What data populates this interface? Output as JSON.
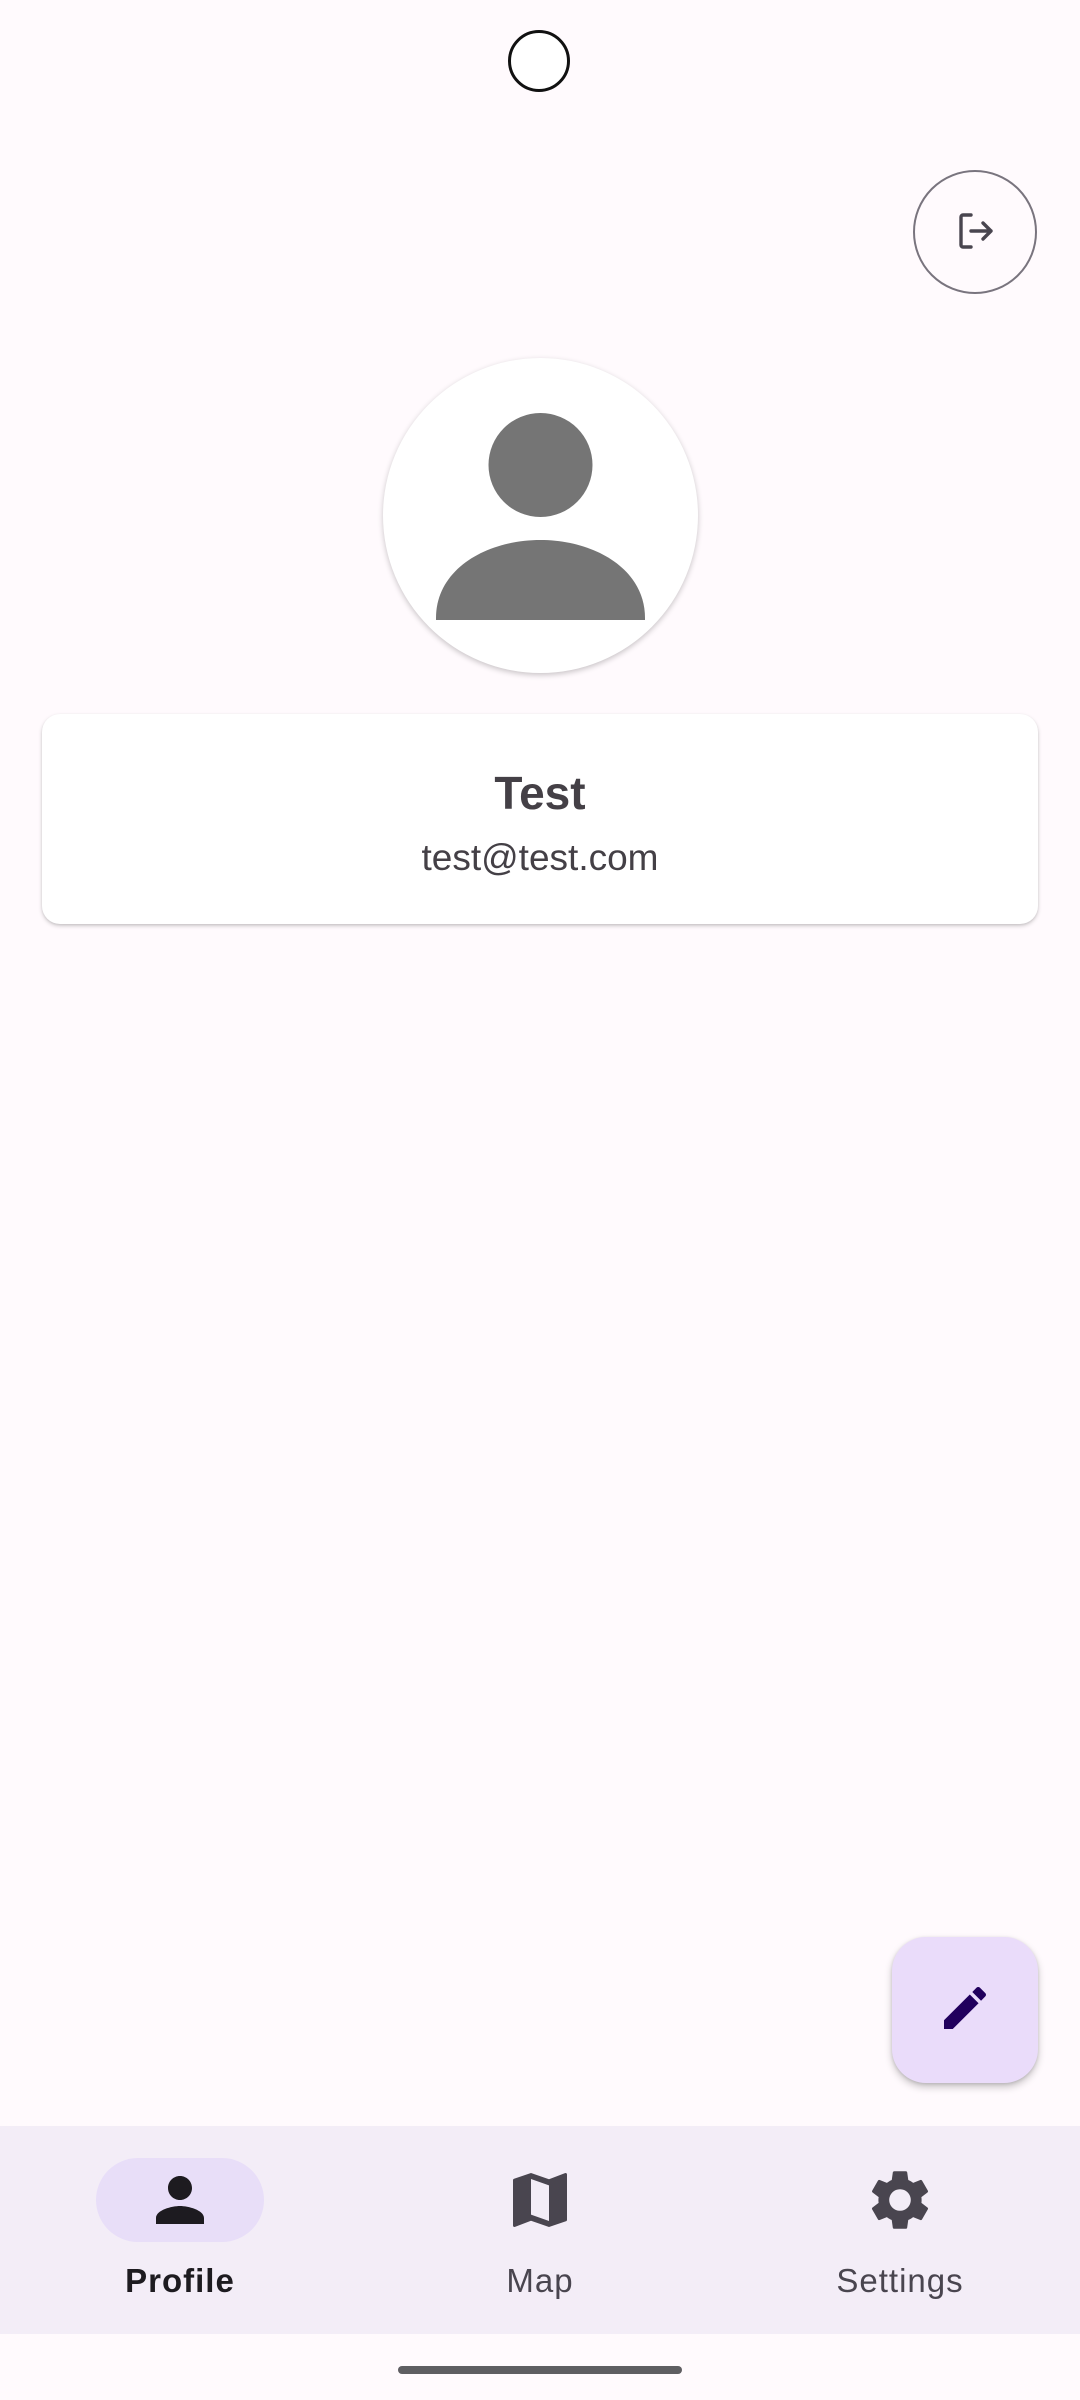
{
  "profile": {
    "name": "Test",
    "email": "test@test.com"
  },
  "icons": {
    "logout": "logout-icon",
    "avatar": "person-placeholder-icon",
    "edit": "pencil-icon"
  },
  "bottom_nav": {
    "items": [
      {
        "label": "Profile",
        "icon": "person-icon",
        "active": true
      },
      {
        "label": "Map",
        "icon": "map-icon",
        "active": false
      },
      {
        "label": "Settings",
        "icon": "gear-icon",
        "active": false
      }
    ]
  },
  "colors": {
    "background": "#fffafd",
    "nav_background": "#f3edf7",
    "active_indicator": "#e8def8",
    "fab_background": "#eadcfa",
    "fab_icon": "#21005d",
    "text_primary": "#444046"
  }
}
